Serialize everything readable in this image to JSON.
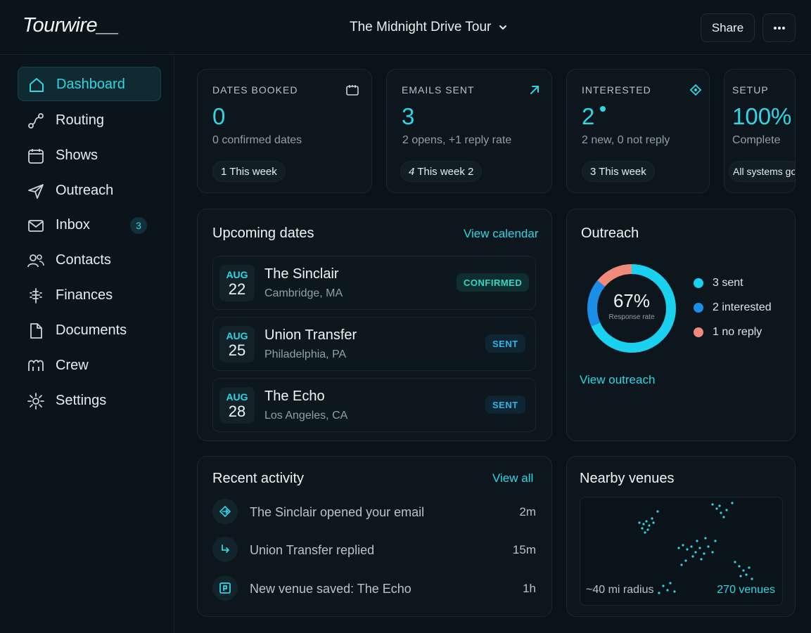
{
  "app": {
    "logo": "Tourwire__",
    "tour_name": "The Midnight Drive Tour",
    "share_label": "Share"
  },
  "sidebar": {
    "items": [
      {
        "label": "Dashboard",
        "icon": "home-icon",
        "active": true
      },
      {
        "label": "Routing",
        "icon": "route-icon"
      },
      {
        "label": "Shows",
        "icon": "calendar-icon"
      },
      {
        "label": "Outreach",
        "icon": "send-icon"
      },
      {
        "label": "Inbox",
        "icon": "mail-icon",
        "badge": "3"
      },
      {
        "label": "Contacts",
        "icon": "users-icon"
      },
      {
        "label": "Finances",
        "icon": "finances-icon"
      },
      {
        "label": "Documents",
        "icon": "document-icon"
      },
      {
        "label": "Crew",
        "icon": "crew-icon"
      },
      {
        "label": "Settings",
        "icon": "gear-icon"
      }
    ]
  },
  "stats": [
    {
      "title": "DATES BOOKED",
      "value": "0",
      "sub": "0 confirmed dates",
      "pill": "1 This week",
      "icon": "calendar-icon"
    },
    {
      "title": "EMAILS SENT",
      "value": "3",
      "sub": "2 opens, +1 reply rate",
      "pill_prefix": "4",
      "pill": "This week 2",
      "icon": "arrow-up-right-icon"
    },
    {
      "title": "INTERESTED",
      "value": "2",
      "sub": "2 new, 0 not reply",
      "pill": "3 This week",
      "icon": "diamond-icon"
    },
    {
      "title": "SETUP",
      "value": "100%",
      "sub": "Complete",
      "pill": "All systems go"
    }
  ],
  "upcoming": {
    "title": "Upcoming dates",
    "link": "View calendar",
    "rows": [
      {
        "month": "AUG",
        "day": "22",
        "venue": "The Sinclair",
        "city": "Cambridge, MA",
        "status": "CONFIRMED"
      },
      {
        "month": "AUG",
        "day": "25",
        "venue": "Union Transfer",
        "city": "Philadelphia, PA",
        "status": "SENT"
      },
      {
        "month": "AUG",
        "day": "28",
        "venue": "The Echo",
        "city": "Los Angeles, CA",
        "status": "SENT"
      }
    ]
  },
  "outreach": {
    "title": "Outreach",
    "percent": "67%",
    "percent_label": "Response rate",
    "link": "View outreach",
    "legend": [
      {
        "label": "3 sent",
        "color": "#1ad1ef"
      },
      {
        "label": "2 interested",
        "color": "#1b8fe8"
      },
      {
        "label": "1 no reply",
        "color": "#f08a7a"
      }
    ]
  },
  "activity": {
    "title": "Recent activity",
    "link": "View all",
    "rows": [
      {
        "text": "The Sinclair opened your email",
        "time": "2m",
        "icon": "open-email-icon"
      },
      {
        "text": "Union Transfer replied",
        "time": "15m",
        "icon": "reply-icon"
      },
      {
        "text": "New venue saved: The Echo",
        "time": "1h",
        "icon": "venue-icon"
      }
    ]
  },
  "nearby": {
    "title": "Nearby venues",
    "radius": "~40 mi radius",
    "count": "270 venues"
  },
  "colors": {
    "accent": "#2fd6e6",
    "background": "#0a1319",
    "card": "#0c161c"
  }
}
